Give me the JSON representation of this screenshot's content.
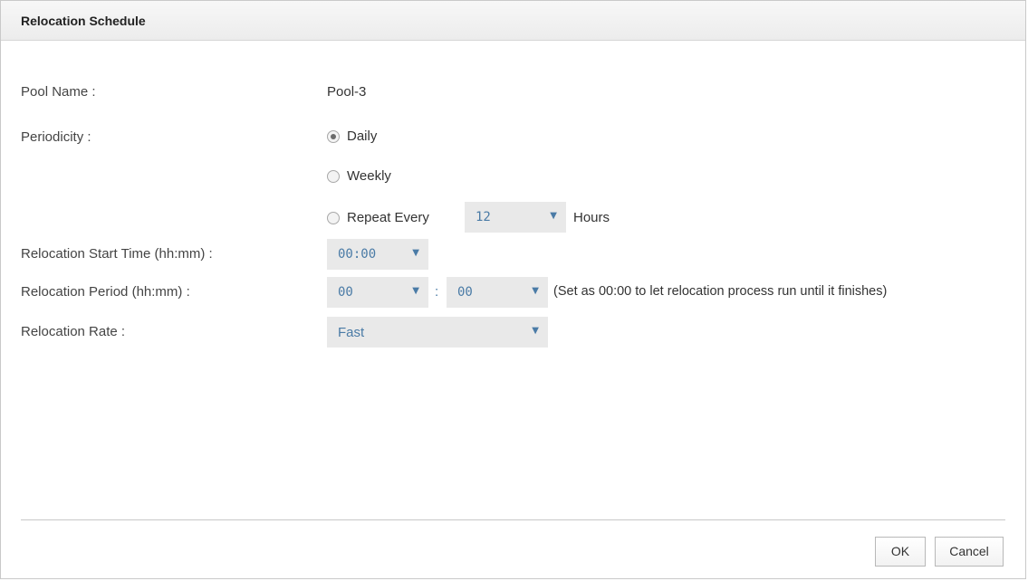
{
  "dialog": {
    "title": "Relocation Schedule"
  },
  "fields": {
    "pool_name": {
      "label": "Pool Name :",
      "value": "Pool-3"
    },
    "periodicity": {
      "label": "Periodicity :",
      "options": [
        {
          "label": "Daily",
          "checked": true
        },
        {
          "label": "Weekly",
          "checked": false
        },
        {
          "label": "Repeat Every",
          "checked": false
        }
      ],
      "repeat_hours_value": "12",
      "repeat_hours_unit": "Hours"
    },
    "start_time": {
      "label": "Relocation Start Time (hh:mm) :",
      "value": "00:00"
    },
    "period": {
      "label": "Relocation Period (hh:mm) :",
      "hours_value": "00",
      "separator": ":",
      "minutes_value": "00",
      "hint": "(Set as 00:00 to let relocation process run until it finishes)"
    },
    "rate": {
      "label": "Relocation Rate :",
      "value": "Fast"
    }
  },
  "buttons": {
    "ok_label": "OK",
    "cancel_label": "Cancel"
  },
  "icons": {
    "dropdown_arrow": "chevron-down-icon"
  },
  "colors": {
    "select_text": "#4a7ba6",
    "select_bg": "#e9e9e9"
  }
}
